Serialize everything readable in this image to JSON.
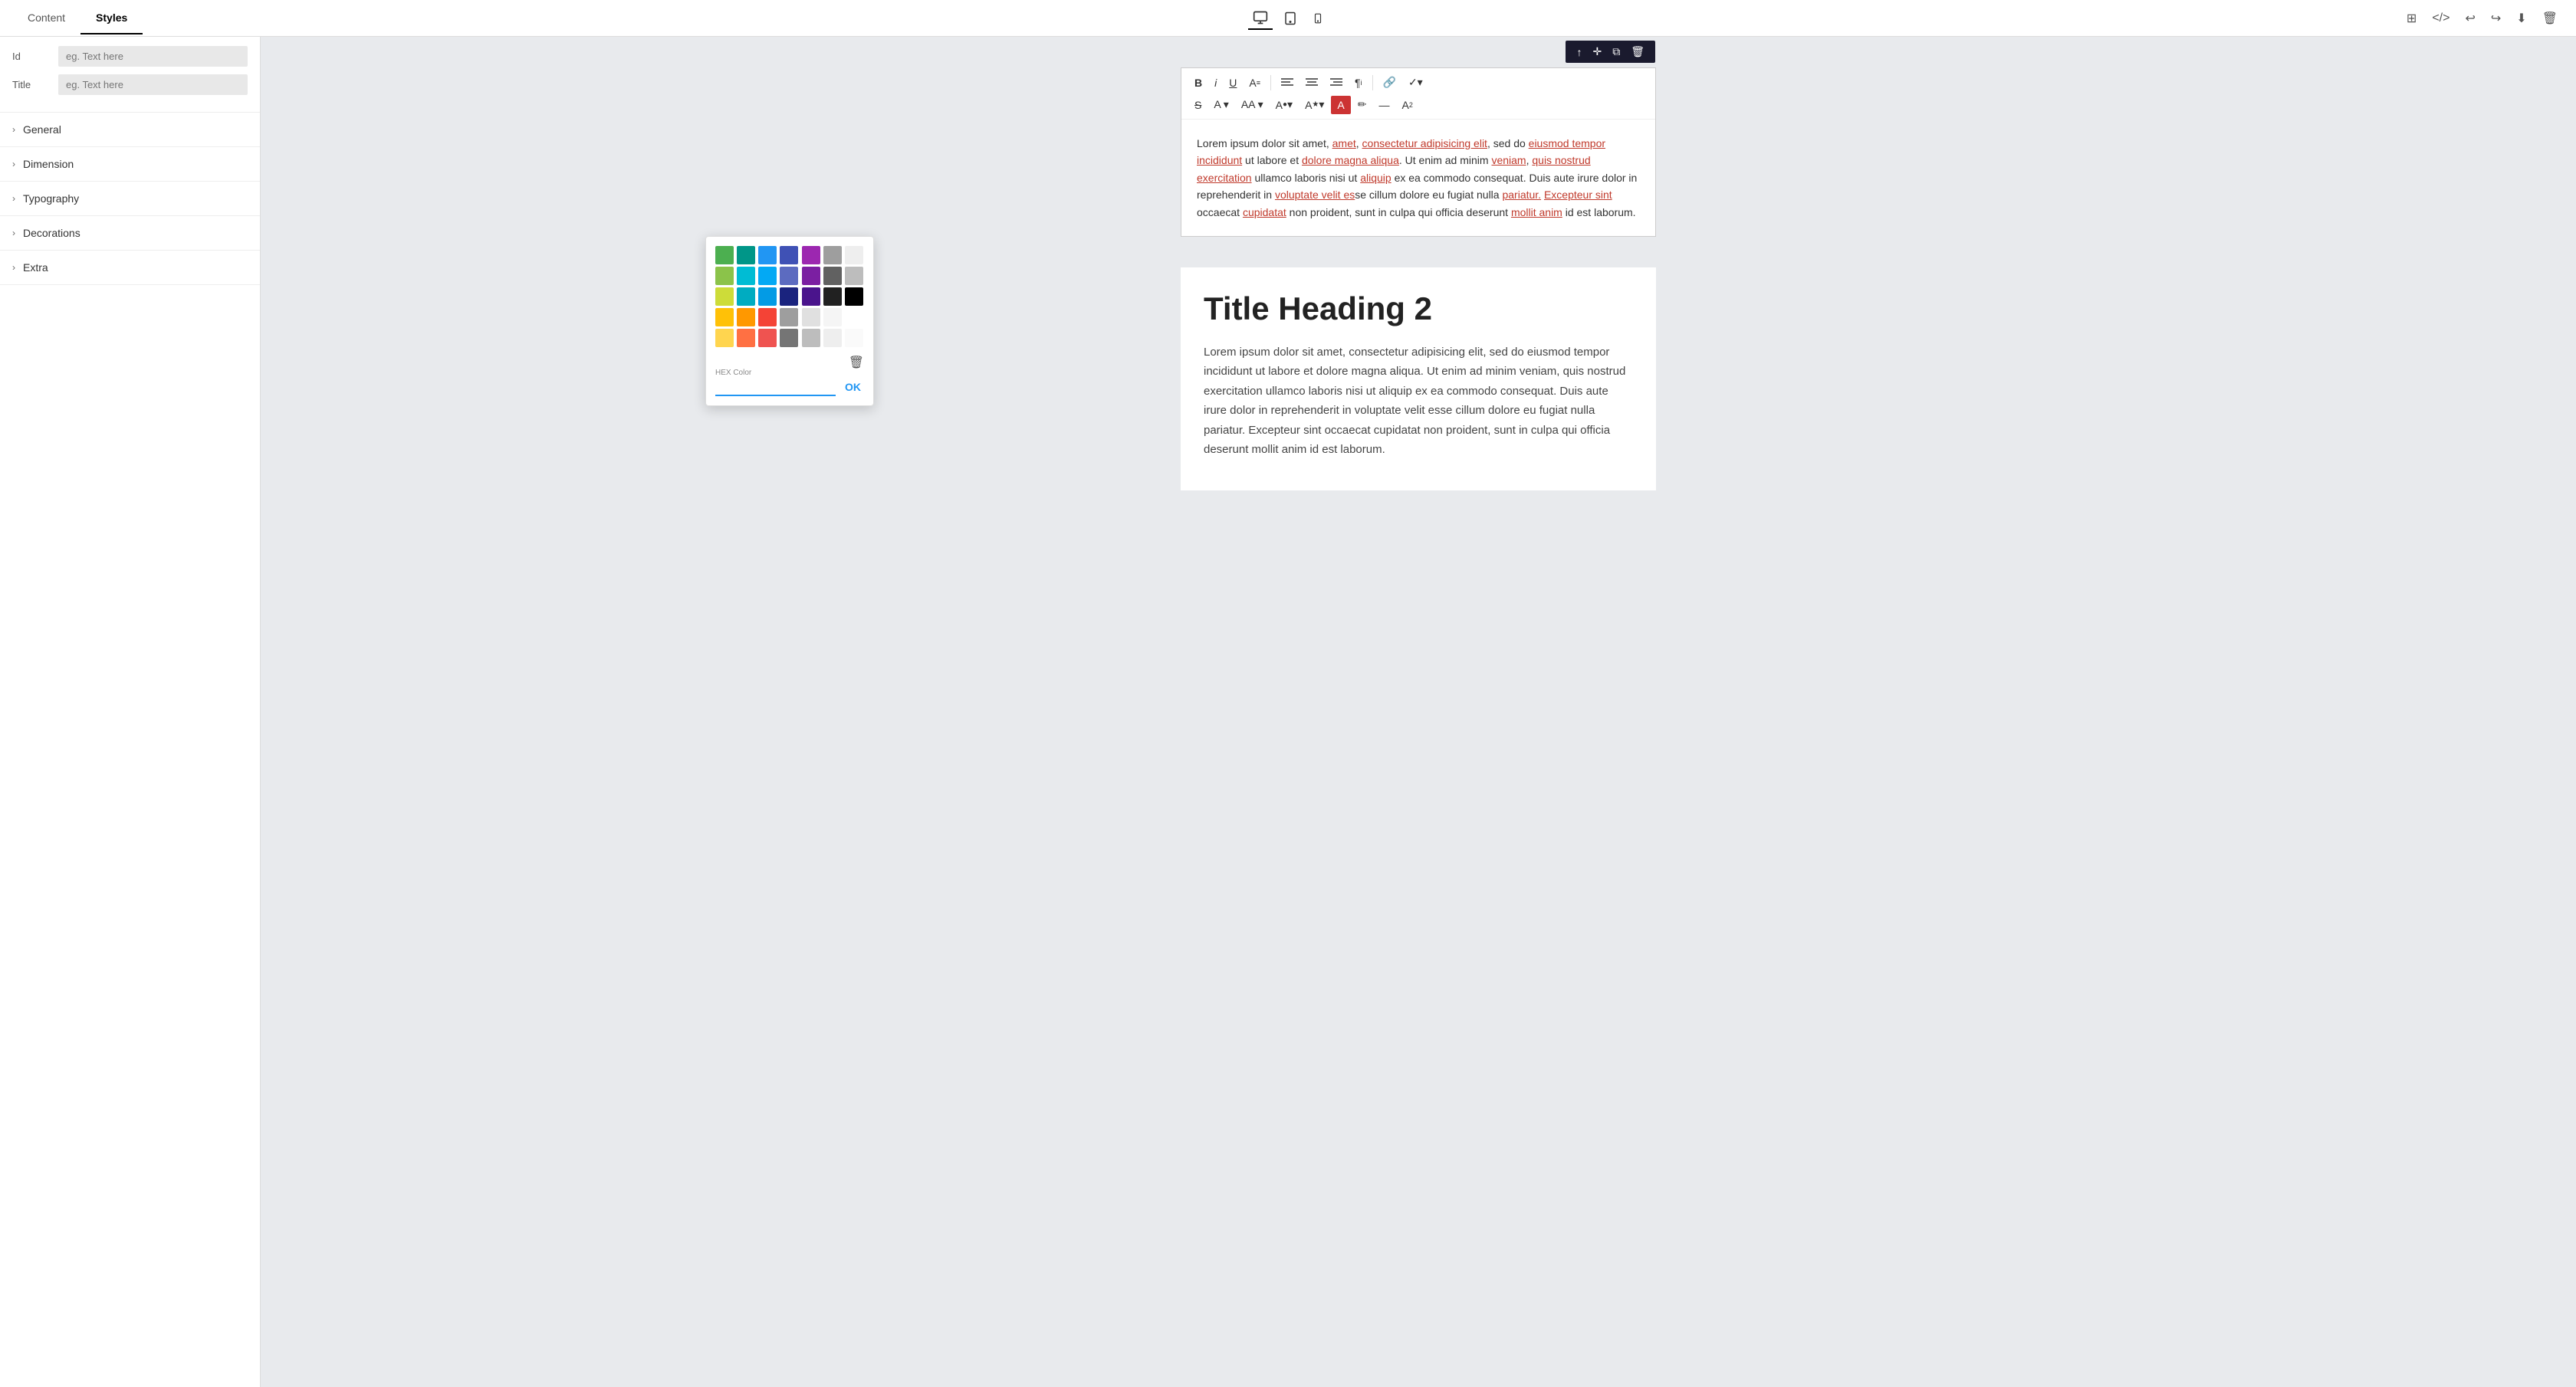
{
  "topbar": {
    "tabs": [
      {
        "id": "content",
        "label": "Content",
        "active": false
      },
      {
        "id": "styles",
        "label": "Styles",
        "active": true
      }
    ],
    "devices": [
      {
        "id": "desktop",
        "icon": "▣",
        "active": true
      },
      {
        "id": "tablet",
        "icon": "▢",
        "active": false
      },
      {
        "id": "mobile",
        "icon": "▯",
        "active": false
      }
    ],
    "right_actions": [
      {
        "id": "grid",
        "icon": "⊞"
      },
      {
        "id": "code",
        "icon": "<>"
      },
      {
        "id": "undo",
        "icon": "↩"
      },
      {
        "id": "redo",
        "icon": "↪"
      },
      {
        "id": "download",
        "icon": "⬇"
      },
      {
        "id": "delete",
        "icon": "🗑"
      }
    ]
  },
  "sidebar": {
    "id_field": {
      "label": "Id",
      "placeholder": "eg. Text here"
    },
    "title_field": {
      "label": "Title",
      "placeholder": "eg. Text here"
    },
    "sections": [
      {
        "id": "general",
        "label": "General"
      },
      {
        "id": "dimension",
        "label": "Dimension"
      },
      {
        "id": "typography",
        "label": "Typography"
      },
      {
        "id": "decorations",
        "label": "Decorations"
      },
      {
        "id": "extra",
        "label": "Extra"
      }
    ]
  },
  "editor": {
    "toolbar_row1": [
      {
        "id": "bold",
        "label": "B",
        "bold": true
      },
      {
        "id": "italic",
        "label": "I",
        "italic": true
      },
      {
        "id": "underline",
        "label": "U̲"
      },
      {
        "id": "fontsize",
        "label": "A≡"
      },
      {
        "id": "sep1",
        "type": "sep"
      },
      {
        "id": "align-left",
        "label": "≡"
      },
      {
        "id": "align-center",
        "label": "≡"
      },
      {
        "id": "align-right",
        "label": "≡"
      },
      {
        "id": "paragraph",
        "label": "¶i"
      },
      {
        "id": "sep2",
        "type": "sep"
      },
      {
        "id": "link",
        "label": "🔗"
      },
      {
        "id": "more",
        "label": "✓▾"
      }
    ],
    "toolbar_row2": [
      {
        "id": "strikethrough",
        "label": "S̶"
      },
      {
        "id": "fontfamily",
        "label": "A▾"
      },
      {
        "id": "fontsize2",
        "label": "AA▾"
      },
      {
        "id": "fontcolor",
        "label": "A●▾"
      },
      {
        "id": "highlight",
        "label": "A★▾"
      },
      {
        "id": "text-highlight",
        "label": "A",
        "active": true
      },
      {
        "id": "eraser",
        "label": "✏"
      },
      {
        "id": "dash",
        "label": "—"
      },
      {
        "id": "superscript",
        "label": "A²"
      }
    ],
    "float_toolbar": [
      {
        "id": "move-up",
        "label": "↑"
      },
      {
        "id": "move",
        "label": "✛"
      },
      {
        "id": "duplicate",
        "label": "⧉"
      },
      {
        "id": "delete",
        "label": "🗑"
      }
    ],
    "content": "Lorem ipsum dolor sit amet, consectetur adipisicing elit, sed do eiusmod tempor incididunt ut labore et dolore magna aliqua. Ut enim ad minim veniam, quis nostrud exercitation ullamco laboris nisi ut aliquip ex ea commodo consequat. Duis aute irure dolor in reprehenderit in voluptate velit esse cillum dolore eu fugiat nulla pariatur. Excepteur sint occaecat cupidatat non proident, sunt in culpa qui officia deserunt mollit anim id est laborum."
  },
  "color_picker": {
    "swatches": [
      "#4CAF50",
      "#009688",
      "#2196F3",
      "#3F51B5",
      "#9C27B0",
      "#9E9E9E",
      "#EEEEEE",
      "#8BC34A",
      "#00BCD4",
      "#03A9F4",
      "#5C6BC0",
      "#7B1FA2",
      "#616161",
      "#BDBDBD",
      "#CDDC39",
      "#00ACC1",
      "#039BE5",
      "#1A237E",
      "#4A148C",
      "#212121",
      "#000000",
      "#FFC107",
      "#FF9800",
      "#F44336",
      "#9E9E9E",
      "#E0E0E0",
      "#F5F5F5",
      "#FFFFFF",
      "#FFD54F",
      "#FF7043",
      "#EF5350",
      "#757575",
      "#BDBDBD",
      "#EEEEEE",
      "#FAFAFA"
    ],
    "hex_label": "HEX Color",
    "hex_value": "",
    "ok_label": "OK"
  },
  "main_content": {
    "title": "Title Heading 2",
    "body": "Lorem ipsum dolor sit amet, consectetur adipisicing elit, sed do eiusmod tempor incididunt ut labore et dolore magna aliqua. Ut enim ad minim veniam, quis nostrud exercitation ullamco laboris nisi ut aliquip ex ea commodo consequat. Duis aute irure dolor in reprehenderit in voluptate velit esse cillum dolore eu fugiat nulla pariatur. Excepteur sint occaecat cupidatat non proident, sunt in culpa qui officia deserunt mollit anim id est laborum."
  }
}
